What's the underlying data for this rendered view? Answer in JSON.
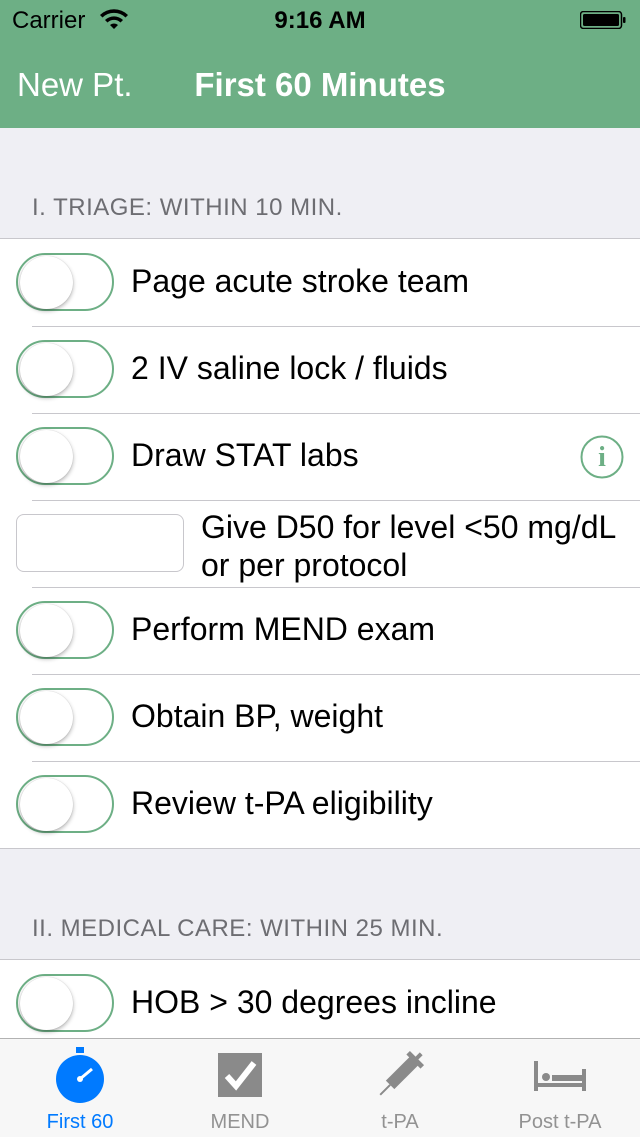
{
  "colors": {
    "accent": "#6daf85",
    "tab_active": "#007aff",
    "tab_inactive": "#929292"
  },
  "status_bar": {
    "carrier": "Carrier",
    "time": "9:16 AM"
  },
  "nav": {
    "back_label": "New Pt.",
    "title": "First 60 Minutes"
  },
  "sections": [
    {
      "header": "I. TRIAGE: WITHIN 10 MIN.",
      "rows": [
        {
          "type": "toggle",
          "label": "Page acute stroke team",
          "on": false
        },
        {
          "type": "toggle",
          "label": "2 IV saline lock / fluids",
          "on": false
        },
        {
          "type": "toggle",
          "label": "Draw STAT labs",
          "on": false,
          "icon": "info-icon"
        },
        {
          "type": "text",
          "label": "Give D50 for level <50 mg/dL or per protocol",
          "value": ""
        },
        {
          "type": "toggle",
          "label": "Perform MEND exam",
          "on": false
        },
        {
          "type": "toggle",
          "label": "Obtain BP, weight",
          "on": false
        },
        {
          "type": "toggle",
          "label": "Review t-PA eligibility",
          "on": false
        }
      ]
    },
    {
      "header": "II. MEDICAL CARE: WITHIN 25 MIN.",
      "rows": [
        {
          "type": "toggle",
          "label": "HOB > 30 degrees incline",
          "on": false
        }
      ]
    }
  ],
  "tabs": [
    {
      "label": "First 60",
      "icon": "stopwatch-icon",
      "active": true
    },
    {
      "label": "MEND",
      "icon": "checkbox-icon",
      "active": false
    },
    {
      "label": "t-PA",
      "icon": "syringe-icon",
      "active": false
    },
    {
      "label": "Post t-PA",
      "icon": "bed-icon",
      "active": false
    }
  ]
}
